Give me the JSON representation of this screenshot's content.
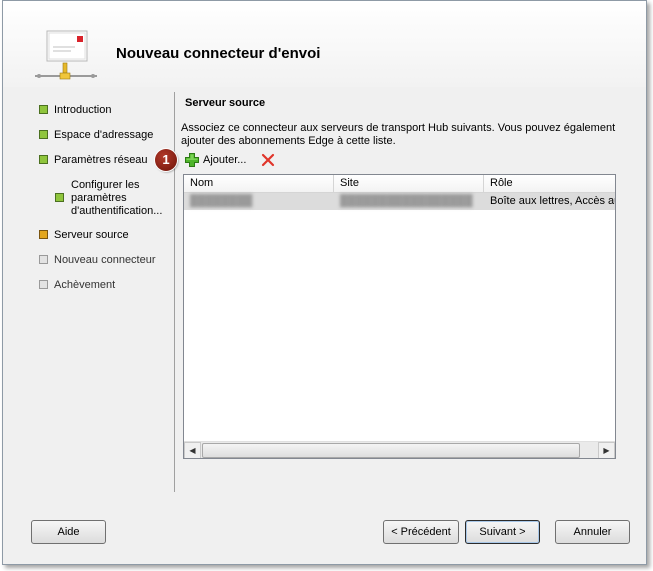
{
  "window": {
    "title": "Nouveau connecteur d'envoi"
  },
  "sidebar": {
    "items": [
      {
        "label": "Introduction",
        "state": "done"
      },
      {
        "label": "Espace d'adressage",
        "state": "done"
      },
      {
        "label": "Paramètres réseau",
        "state": "done"
      },
      {
        "label": "Configurer les paramètres d'authentification...",
        "state": "done"
      },
      {
        "label": "Serveur source",
        "state": "current"
      },
      {
        "label": "Nouveau connecteur",
        "state": "pending"
      },
      {
        "label": "Achèvement",
        "state": "pending"
      }
    ]
  },
  "main": {
    "section_title": "Serveur source",
    "description": "Associez ce connecteur aux serveurs de transport Hub suivants. Vous pouvez également ajouter des abonnements Edge à cette liste.",
    "step_badge": "1",
    "toolbar": {
      "add_label": "Ajouter...",
      "add_icon": "add-icon",
      "remove_icon": "remove-icon"
    },
    "list": {
      "columns": [
        "Nom",
        "Site",
        "Rôle"
      ],
      "rows": [
        {
          "nom": "████████",
          "site": "█████████████████",
          "role": "Boîte aux lettres, Accès au"
        }
      ]
    }
  },
  "footer": {
    "help_label": "Aide",
    "back_label": "< Précédent",
    "next_label": "Suivant >",
    "cancel_label": "Annuler"
  },
  "colors": {
    "done": "#8fc53c",
    "current": "#e2a61e",
    "pending": "#e3e3e3",
    "badge": "#8b1a0e"
  }
}
